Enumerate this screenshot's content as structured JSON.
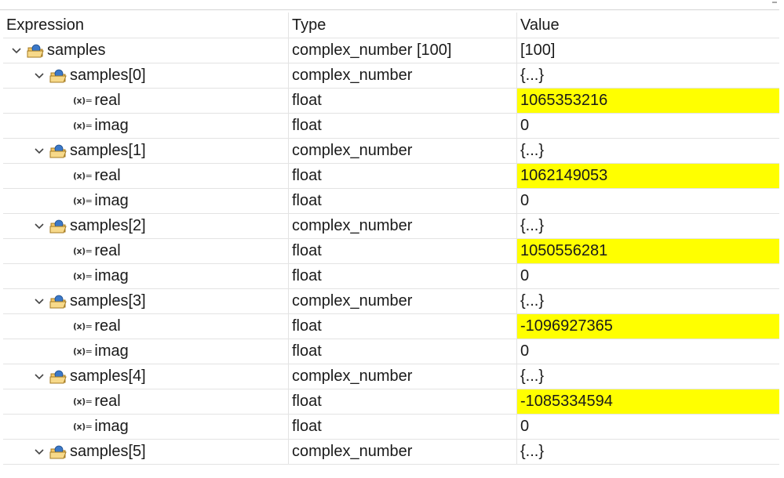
{
  "columns": {
    "expression": "Expression",
    "type": "Type",
    "value": "Value"
  },
  "root": {
    "name": "samples",
    "type": "complex_number [100]",
    "value": "[100]"
  },
  "element_type": "complex_number",
  "element_value": "{...}",
  "field_type": "float",
  "icons": {
    "expand": "chevron-down-icon",
    "struct": "open-folder-icon",
    "variable": "variable-x-icon"
  },
  "colors": {
    "highlight": "#ffff00"
  },
  "items": [
    {
      "name": "samples[0]",
      "real_label": "real",
      "real": "1065353216",
      "imag_label": "imag",
      "imag": "0"
    },
    {
      "name": "samples[1]",
      "real_label": "real",
      "real": "1062149053",
      "imag_label": "imag",
      "imag": "0"
    },
    {
      "name": "samples[2]",
      "real_label": "real",
      "real": "1050556281",
      "imag_label": "imag",
      "imag": "0"
    },
    {
      "name": "samples[3]",
      "real_label": "real",
      "real": "-1096927365",
      "imag_label": "imag",
      "imag": "0"
    },
    {
      "name": "samples[4]",
      "real_label": "real",
      "real": "-1085334594",
      "imag_label": "imag",
      "imag": "0"
    },
    {
      "name": "samples[5]"
    }
  ]
}
